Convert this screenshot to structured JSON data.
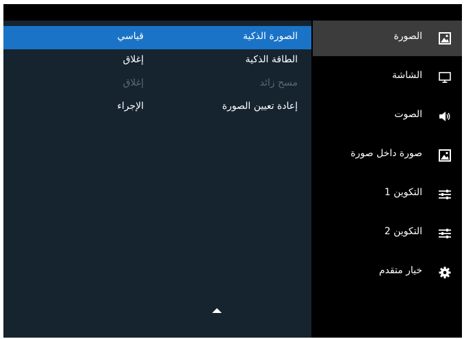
{
  "settings": {
    "rows": [
      {
        "name": "الصورة الذكية",
        "value": "قياسي"
      },
      {
        "name": "الطاقة الذكية",
        "value": "إغلاق"
      },
      {
        "name": "مسح زائد",
        "value": "إغلاق"
      },
      {
        "name": "إعادة تعيين الصورة",
        "value": "الإجراء"
      }
    ]
  },
  "menu": {
    "items": [
      {
        "label": "الصورة",
        "icon": "picture-icon"
      },
      {
        "label": "الشاشة",
        "icon": "monitor-icon"
      },
      {
        "label": "الصوت",
        "icon": "speaker-icon"
      },
      {
        "label": "صورة داخل صورة",
        "icon": "pip-icon"
      },
      {
        "label": "التكوين 1",
        "icon": "sliders-icon"
      },
      {
        "label": "التكوين 2",
        "icon": "sliders-icon"
      },
      {
        "label": "خيار متقدم",
        "icon": "gear-icon"
      }
    ]
  },
  "colors": {
    "content_bg": "#162430",
    "selected_row": "#1a73c7",
    "active_menu": "#3c3c3c",
    "disabled_text": "#5d6a75"
  }
}
